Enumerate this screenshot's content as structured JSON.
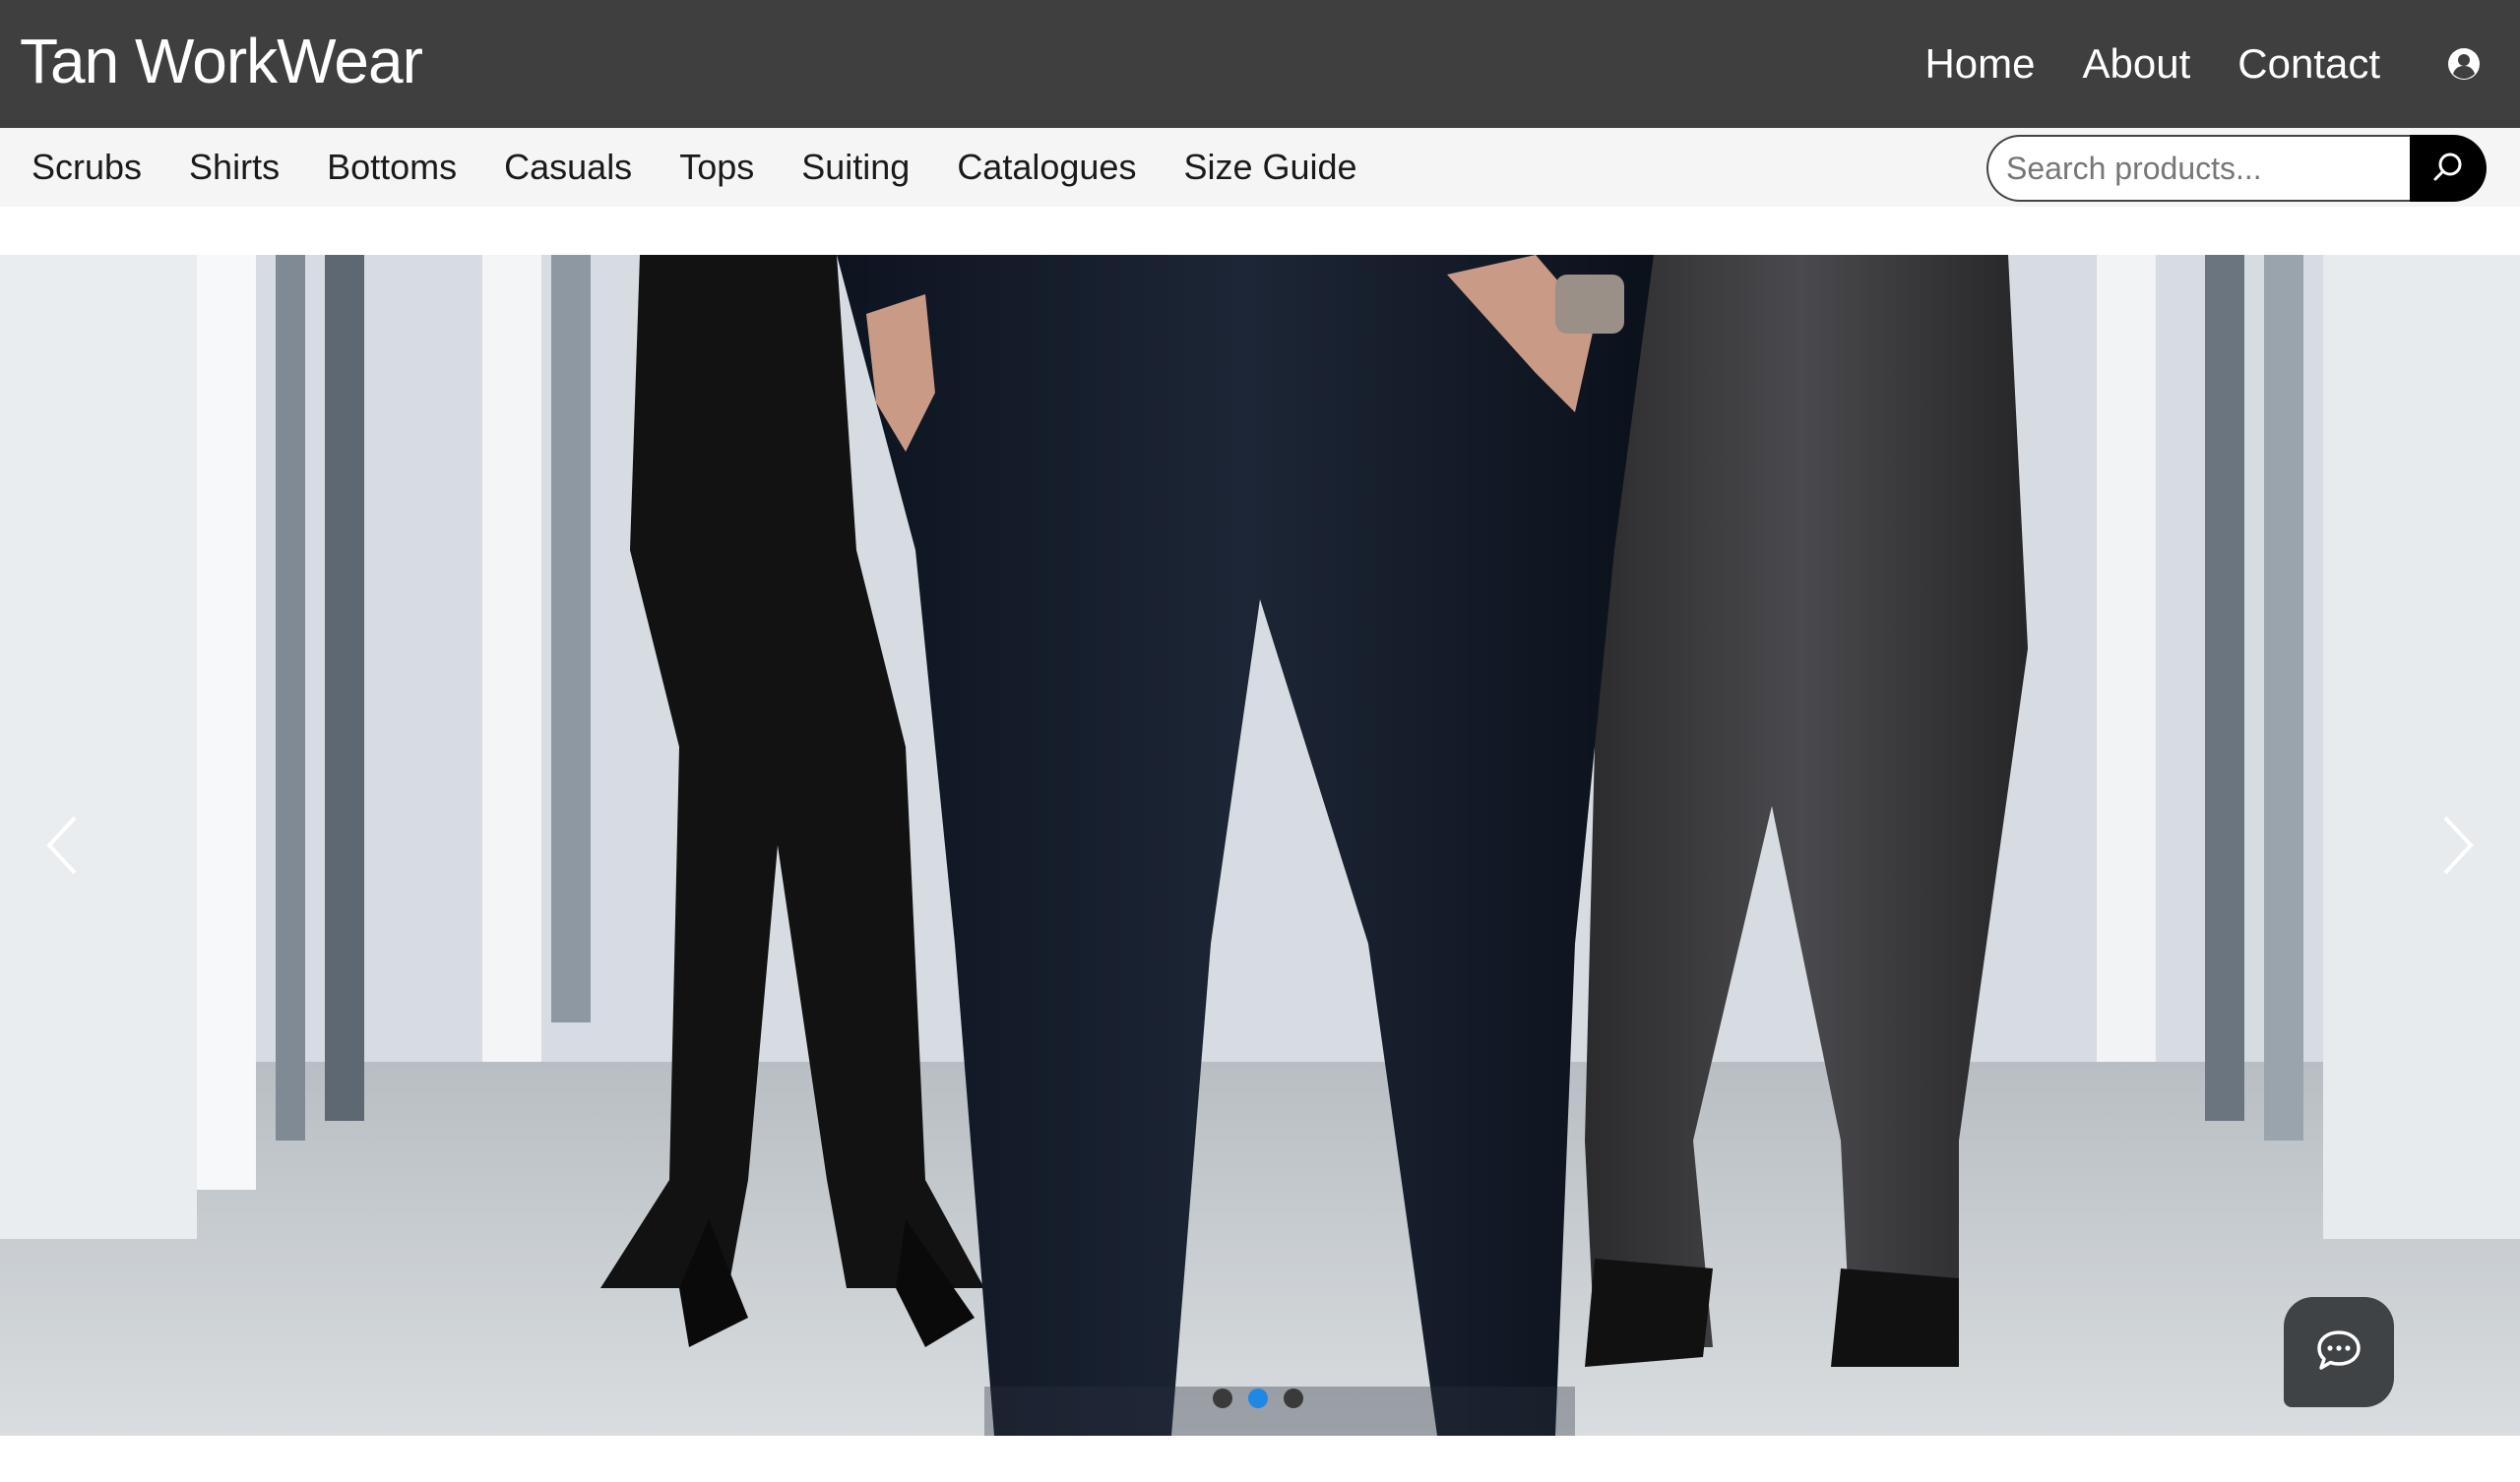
{
  "header": {
    "brand": "Tan WorkWear",
    "nav": [
      {
        "label": "Home"
      },
      {
        "label": "About"
      },
      {
        "label": "Contact"
      }
    ],
    "user_icon": "user-circle-icon"
  },
  "categories": {
    "items": [
      {
        "label": "Scrubs"
      },
      {
        "label": "Shirts"
      },
      {
        "label": "Bottoms"
      },
      {
        "label": "Casuals"
      },
      {
        "label": "Tops"
      },
      {
        "label": "Suiting"
      },
      {
        "label": "Catalogues"
      },
      {
        "label": "Size Guide"
      }
    ]
  },
  "search": {
    "placeholder": "Search products...",
    "value": "",
    "button_icon": "search-icon"
  },
  "carousel": {
    "slide_count": 3,
    "active_index": 1,
    "prev_icon": "chevron-left-icon",
    "next_icon": "chevron-right-icon"
  },
  "chat_widget": {
    "icon": "chat-bubble-icon"
  },
  "colors": {
    "topbar": "#3f3f3f",
    "catbar": "#f5f5f5",
    "active_dot": "#1e88e5",
    "inactive_dot": "#3a3a3a",
    "search_button": "#000000"
  }
}
